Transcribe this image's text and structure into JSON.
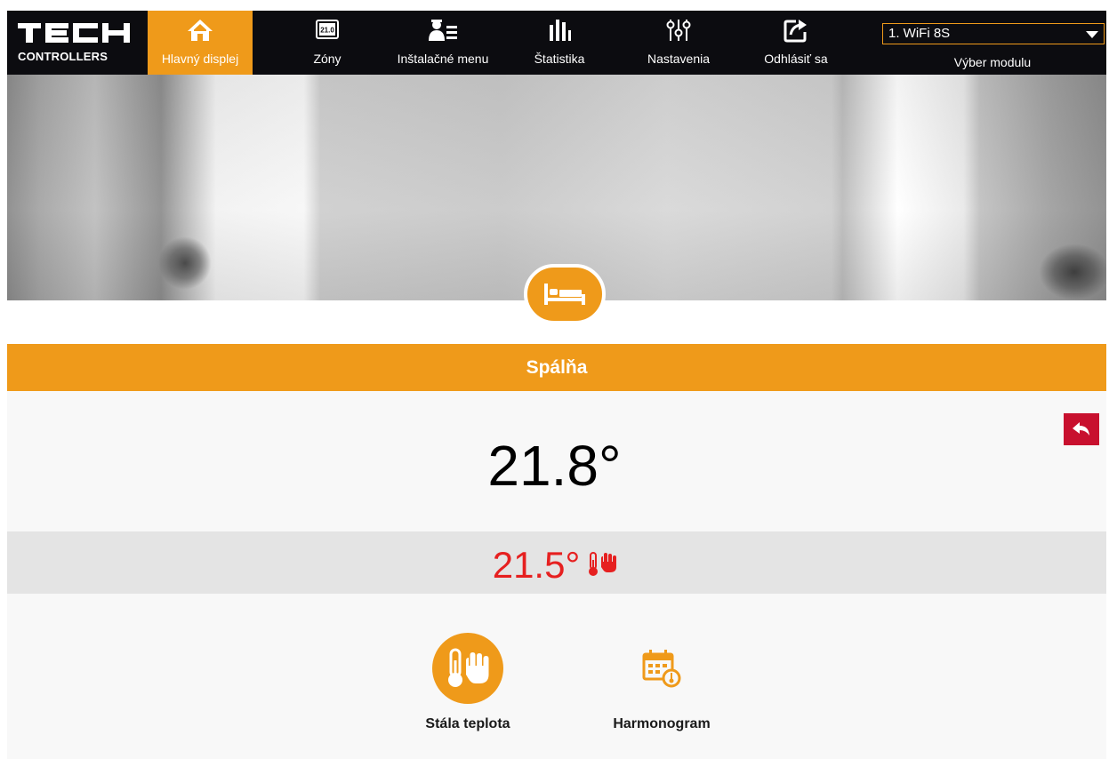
{
  "brand": {
    "name": "TECH",
    "sub": "CONTROLLERS"
  },
  "nav": {
    "items": [
      {
        "label": "Hlavný displej",
        "icon": "home-icon"
      },
      {
        "label": "Zóny",
        "icon": "zone-display-icon",
        "icon_text": "21.0"
      },
      {
        "label": "Inštalačné menu",
        "icon": "installer-icon"
      },
      {
        "label": "Štatistika",
        "icon": "statistics-icon"
      },
      {
        "label": "Nastavenia",
        "icon": "settings-sliders-icon"
      },
      {
        "label": "Odhlásiť sa",
        "icon": "logout-icon"
      }
    ],
    "active_index": 0
  },
  "module": {
    "selected": "1. WiFi 8S",
    "label": "Výber modulu"
  },
  "zone": {
    "name": "Spálňa",
    "icon": "bed-icon",
    "current_temp": "21.8°",
    "set_temp": "21.5°",
    "set_temp_icon": "thermometer-hand-icon"
  },
  "modes": [
    {
      "label": "Stála teplota",
      "icon": "thermometer-hand-icon",
      "active": true
    },
    {
      "label": "Harmonogram",
      "icon": "calendar-clock-icon",
      "active": false
    }
  ],
  "colors": {
    "accent": "#ef9a1a",
    "nav_bg": "#0c0c10",
    "set_temp": "#e62020",
    "back": "#c8102e"
  }
}
